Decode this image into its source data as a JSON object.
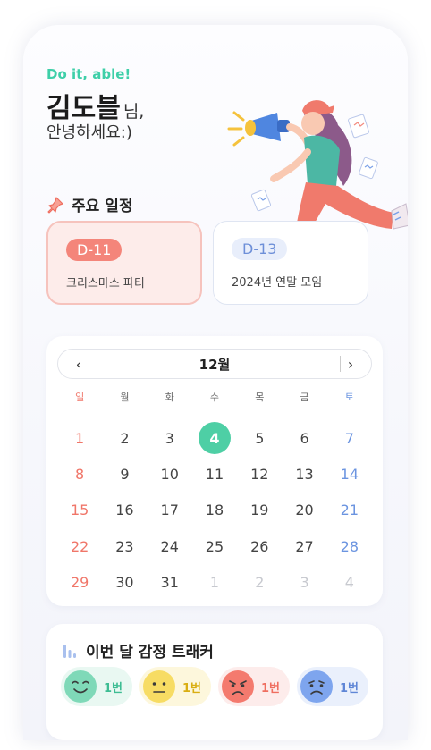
{
  "header": {
    "tagline": "Do it, able!",
    "user_name": "김도블",
    "name_suffix": "님,",
    "greeting": "안녕하세요:)"
  },
  "schedule": {
    "title": "주요 일정",
    "icon": "pin-icon",
    "events": [
      {
        "dday": "D-11",
        "label": "크리스마스 파티",
        "accent": "#f4857a"
      },
      {
        "dday": "D-13",
        "label": "2024년 연말 모임",
        "accent": "#6d8fd8"
      }
    ]
  },
  "calendar": {
    "month": "12월",
    "prev_icon": "chevron-left-icon",
    "next_icon": "chevron-right-icon",
    "weekdays": [
      "일",
      "월",
      "화",
      "수",
      "목",
      "금",
      "토"
    ],
    "today": "4",
    "accent": "#4ecfa5",
    "weeks": [
      [
        "1",
        "2",
        "3",
        "4",
        "5",
        "6",
        "7"
      ],
      [
        "8",
        "9",
        "10",
        "11",
        "12",
        "13",
        "14"
      ],
      [
        "15",
        "16",
        "17",
        "18",
        "19",
        "20",
        "21"
      ],
      [
        "22",
        "23",
        "24",
        "25",
        "26",
        "27",
        "28"
      ],
      [
        "29",
        "30",
        "31",
        "1",
        "2",
        "3",
        "4"
      ]
    ]
  },
  "emotion_tracker": {
    "title": "이번 달 감정 트래커",
    "icon": "bar-chart-icon",
    "items": [
      {
        "emotion": "happy",
        "count": "1번",
        "color": "#7fd9b8"
      },
      {
        "emotion": "neutral",
        "count": "1번",
        "color": "#f7dc63"
      },
      {
        "emotion": "angry",
        "count": "1번",
        "color": "#f47a6e"
      },
      {
        "emotion": "sad",
        "count": "1번",
        "color": "#7ea5ee"
      }
    ]
  }
}
